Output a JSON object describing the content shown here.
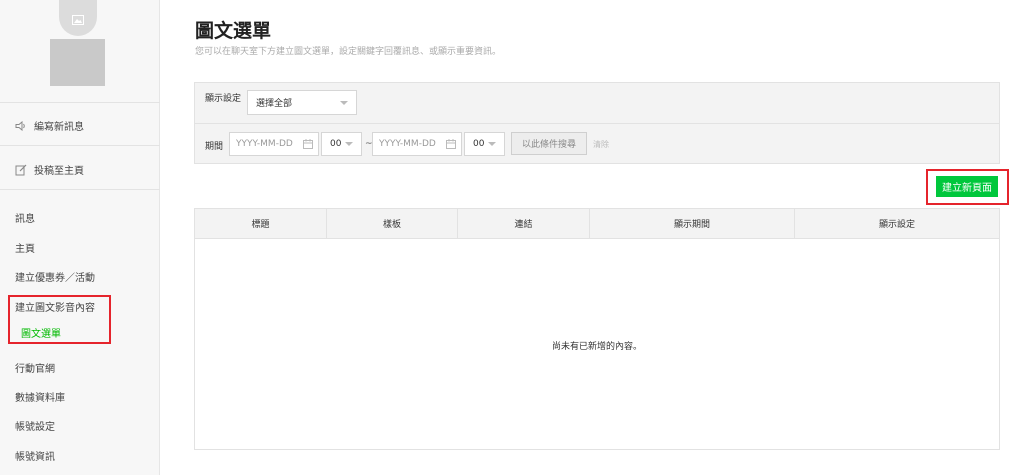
{
  "sidebar": {
    "actions": [
      {
        "label": "編寫新訊息",
        "icon": "speaker-icon"
      },
      {
        "label": "投稿至主頁",
        "icon": "edit-icon"
      }
    ],
    "items": [
      {
        "label": "訊息"
      },
      {
        "label": "主頁"
      },
      {
        "label": "建立優惠券／活動"
      },
      {
        "label": "建立圖文影音內容"
      },
      {
        "label": "行動官網"
      },
      {
        "label": "數據資料庫"
      },
      {
        "label": "帳號設定"
      },
      {
        "label": "帳號資訊"
      }
    ],
    "sub_item": {
      "label": "圖文選單"
    }
  },
  "page": {
    "title": "圖文選單",
    "subtitle": "您可以在聊天室下方建立圖文選單，設定關鍵字回覆訊息、或顯示重要資訊。"
  },
  "filter": {
    "display_label": "顯示設定",
    "display_value": "選擇全部",
    "period_label": "期間",
    "start_date_placeholder": "YYYY-MM-DD",
    "start_hour": "00",
    "tilde": "~",
    "end_date_placeholder": "YYYY-MM-DD",
    "end_hour": "00",
    "search_label": "以此條件搜尋",
    "clear_label": "清除"
  },
  "create_button": {
    "label": "建立新頁面"
  },
  "table": {
    "headers": [
      "標題",
      "樣板",
      "連結",
      "顯示期間",
      "顯示設定"
    ],
    "empty_message": "尚未有已新增的內容。"
  },
  "colors": {
    "accent_green": "#00c73c",
    "highlight_red": "#e5242c"
  }
}
